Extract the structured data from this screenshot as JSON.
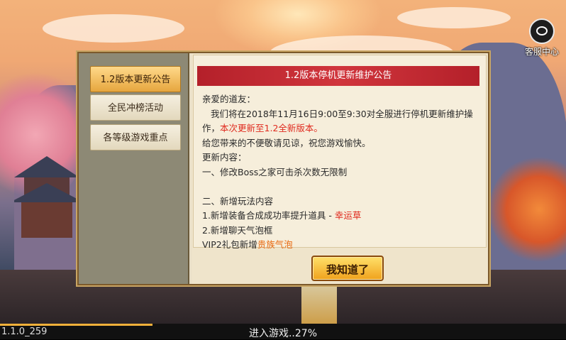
{
  "customer_service": {
    "label": "客服中心",
    "icon": "headset-icon"
  },
  "sidebar": {
    "tabs": [
      {
        "label": "1.2版本更新公告",
        "active": true
      },
      {
        "label": "全民冲榜活动",
        "active": false
      },
      {
        "label": "各等级游戏重点",
        "active": false
      }
    ]
  },
  "notice": {
    "title": "1.2版本停机更新维护公告",
    "greeting": "亲爱的道友：",
    "line1": "我们将在2018年11月16日9:00至9:30对全服进行停机更新维护操",
    "line2_prefix": "作，",
    "line2_highlight": "本次更新至1.2全新版本。",
    "line3": "给您带来的不便敬请见谅，祝您游戏愉快。",
    "line4": "更新内容：",
    "line5": "一、修改Boss之家可击杀次数无限制",
    "line6": "二、新增玩法内容",
    "line7_prefix": "1.新增装备合成成功率提升道具 - ",
    "line7_highlight": "幸运草",
    "line8": "2.新增聊天气泡框",
    "line9_prefix": "VIP2礼包新增",
    "line9_highlight": "贵族气泡",
    "colors": {
      "title_bg": "#c8282f",
      "highlight_red": "#e02b1f",
      "highlight_orange": "#e86a12"
    }
  },
  "confirm_button": {
    "label": "我知道了"
  },
  "footer": {
    "version": "1.1.0_259",
    "loading_text": "进入游戏..27%",
    "progress_percent": 27
  }
}
